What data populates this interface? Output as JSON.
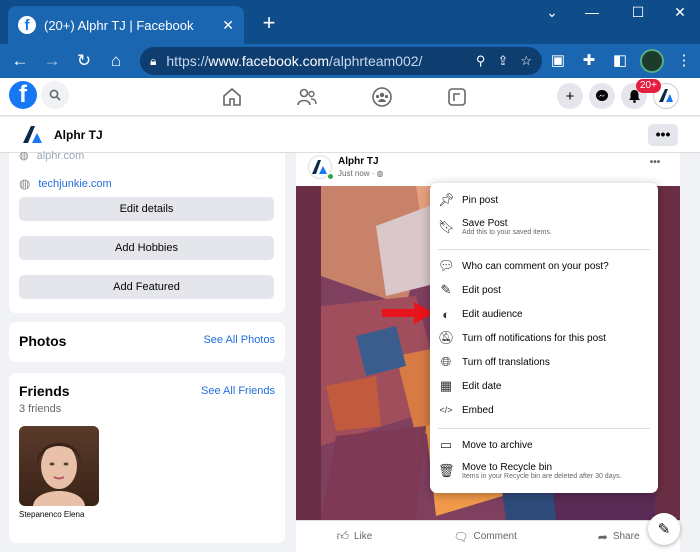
{
  "browser": {
    "tab_title": "(20+) Alphr TJ | Facebook",
    "url_prefix": "https://",
    "url_host": "www.facebook.com",
    "url_path": "/alphrteam002/"
  },
  "facebook": {
    "notif_badge": "20+",
    "profile_name": "Alphr TJ",
    "dots": "•••"
  },
  "intro": {
    "link1": "alphr.com",
    "link2": "techjunkie.com",
    "edit_details": "Edit details",
    "add_hobbies": "Add Hobbies",
    "add_featured": "Add Featured"
  },
  "photos": {
    "title": "Photos",
    "see_all": "See All Photos"
  },
  "friends": {
    "title": "Friends",
    "see_all": "See All Friends",
    "count": "3 friends",
    "friend_name": "Stepanenco Elena"
  },
  "post": {
    "author": "Alphr TJ",
    "time": "Just now ·",
    "like": "Like",
    "comment": "Comment",
    "share": "Share"
  },
  "menu": {
    "pin": "Pin post",
    "save": "Save Post",
    "save_sub": "Add this to your saved items.",
    "who_comment": "Who can comment on your post?",
    "edit_post": "Edit post",
    "edit_audience": "Edit audience",
    "turn_off_notif": "Turn off notifications for this post",
    "turn_off_trans": "Turn off translations",
    "edit_date": "Edit date",
    "embed": "Embed",
    "archive": "Move to archive",
    "recycle": "Move to Recycle bin",
    "recycle_sub": "Items in your Recycle bin are deleted after 30 days."
  },
  "colors": {
    "brand": "#1877f2",
    "chrome": "#1a66b0",
    "arrow": "#e8141b"
  }
}
